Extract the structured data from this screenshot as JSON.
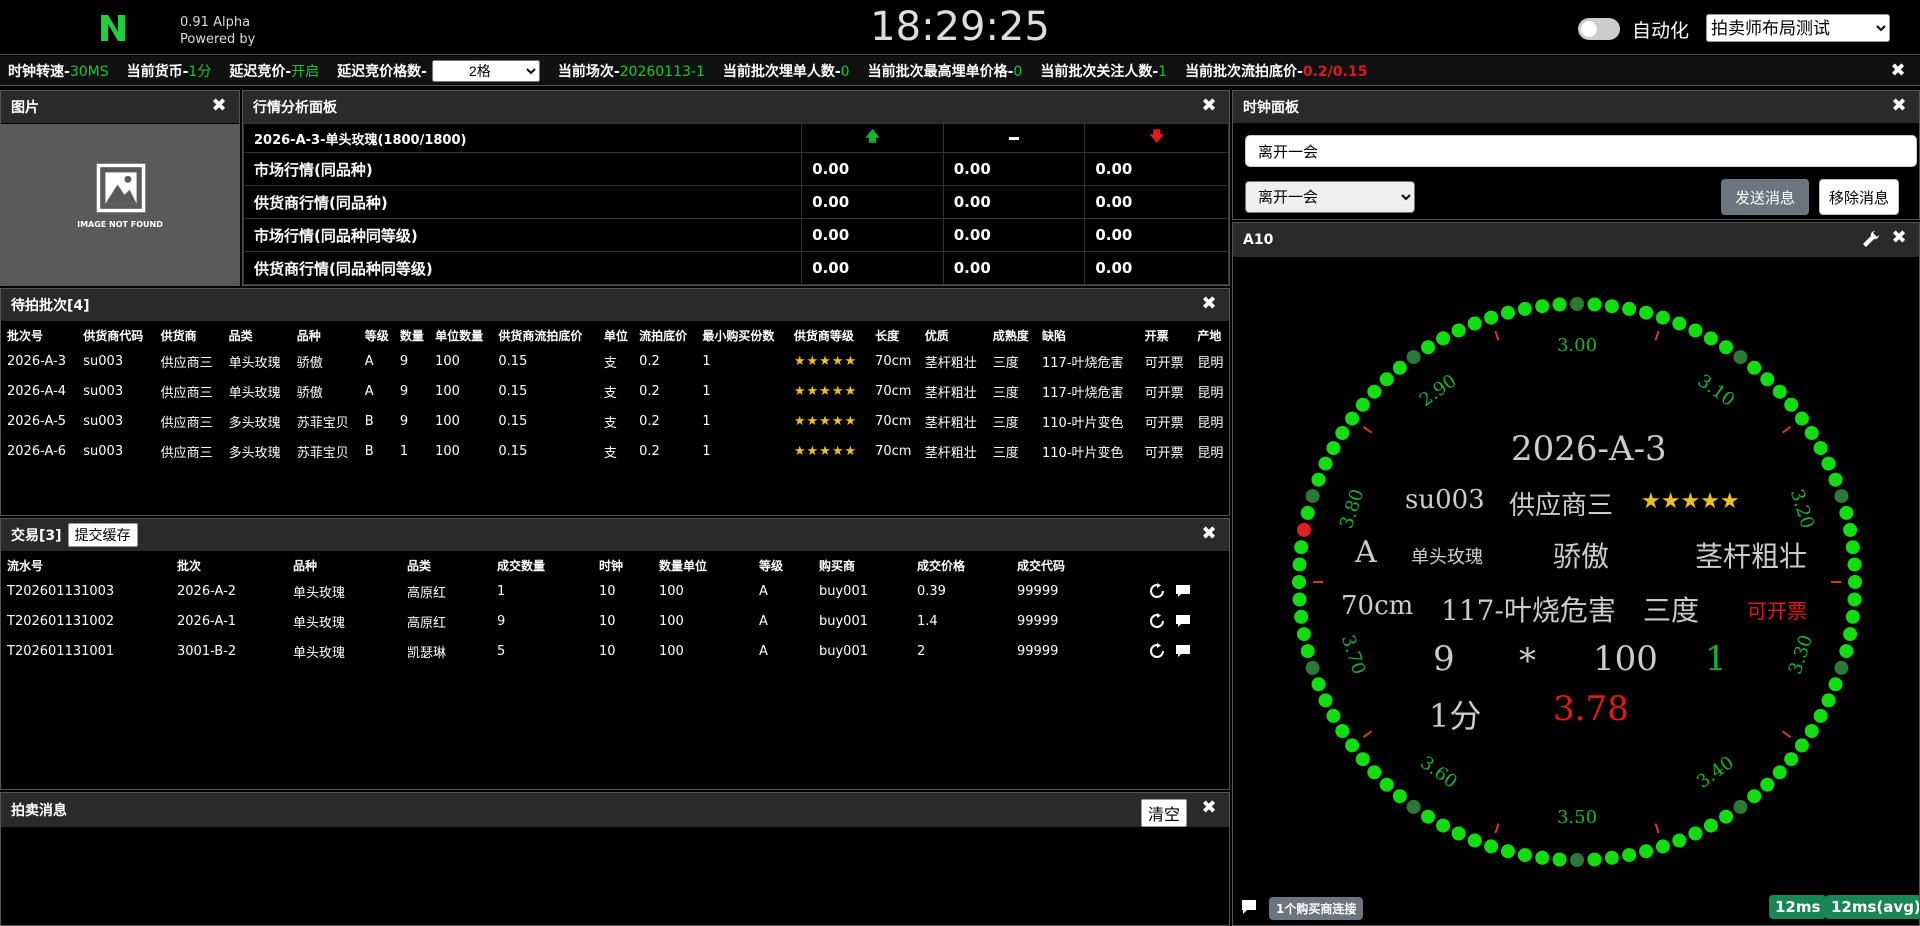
{
  "header": {
    "version": "0.91 Alpha",
    "powered_by": "Powered by",
    "clock": "18:29:25",
    "auto_label": "自动化",
    "layout_selected": "拍卖师布局测试"
  },
  "status": {
    "clock_speed_label": "时钟转速-",
    "clock_speed": "30MS",
    "currency_label": "当前货币-",
    "currency": "1分",
    "delay_label": "延迟竞价-",
    "delay": "开启",
    "delay_count_label": "延迟竞价格数-",
    "delay_count": "2格",
    "session_label": "当前场次-",
    "session": "20260113-1",
    "bidders_label": "当前批次埋单人数-",
    "bidders": "0",
    "max_bid_label": "当前批次最高埋单价格-",
    "max_bid": "0",
    "followers_label": "当前批次关注人数-",
    "followers": "1",
    "floor_label": "当前批次流拍底价-",
    "floor": "0.2/0.15"
  },
  "image_panel": {
    "title": "图片",
    "placeholder": "IMAGE NOT FOUND"
  },
  "market_panel": {
    "title": "行情分析面板",
    "lot_label": "2026-A-3-单头玫瑰(1800/1800)",
    "rows": [
      {
        "label": "市场行情(同品种)",
        "v1": "0.00",
        "v2": "0.00",
        "v3": "0.00"
      },
      {
        "label": "供货商行情(同品种)",
        "v1": "0.00",
        "v2": "0.00",
        "v3": "0.00"
      },
      {
        "label": "市场行情(同品种同等级)",
        "v1": "0.00",
        "v2": "0.00",
        "v3": "0.00"
      },
      {
        "label": "供货商行情(同品种同等级)",
        "v1": "0.00",
        "v2": "0.00",
        "v3": "0.00"
      }
    ]
  },
  "pending_panel": {
    "title": "待拍批次[4]",
    "headers": [
      "批次号",
      "供货商代码",
      "供货商",
      "品类",
      "品种",
      "等级",
      "数量",
      "单位数量",
      "供货商流拍底价",
      "单位",
      "流拍底价",
      "最小购买份数",
      "供货商等级",
      "长度",
      "优质",
      "成熟度",
      "缺陷",
      "开票",
      "产地"
    ],
    "rows": [
      [
        "2026-A-3",
        "su003",
        "供应商三",
        "单头玫瑰",
        "骄傲",
        "A",
        "9",
        "100",
        "0.15",
        "支",
        "0.2",
        "1",
        "★★★★★",
        "70cm",
        "茎杆粗壮",
        "三度",
        "117-叶烧危害",
        "可开票",
        "昆明"
      ],
      [
        "2026-A-4",
        "su003",
        "供应商三",
        "单头玫瑰",
        "骄傲",
        "A",
        "9",
        "100",
        "0.15",
        "支",
        "0.2",
        "1",
        "★★★★★",
        "70cm",
        "茎杆粗壮",
        "三度",
        "117-叶烧危害",
        "可开票",
        "昆明"
      ],
      [
        "2026-A-5",
        "su003",
        "供应商三",
        "多头玫瑰",
        "苏菲宝贝",
        "B",
        "9",
        "100",
        "0.15",
        "支",
        "0.2",
        "1",
        "★★★★★",
        "70cm",
        "茎杆粗壮",
        "三度",
        "110-叶片变色",
        "可开票",
        "昆明"
      ],
      [
        "2026-A-6",
        "su003",
        "供应商三",
        "多头玫瑰",
        "苏菲宝贝",
        "B",
        "1",
        "100",
        "0.15",
        "支",
        "0.2",
        "1",
        "★★★★★",
        "70cm",
        "茎杆粗壮",
        "三度",
        "110-叶片变色",
        "可开票",
        "昆明"
      ]
    ]
  },
  "trade_panel": {
    "title": "交易[3]",
    "commit_label": "提交缓存",
    "headers": [
      "流水号",
      "批次",
      "品种",
      "品类",
      "成交数量",
      "时钟",
      "数量单位",
      "等级",
      "购买商",
      "成交价格",
      "成交代码"
    ],
    "rows": [
      [
        "T202601131003",
        "2026-A-2",
        "单头玫瑰",
        "高原红",
        "1",
        "10",
        "100",
        "A",
        "buy001",
        "0.39",
        "99999"
      ],
      [
        "T202601131002",
        "2026-A-1",
        "单头玫瑰",
        "高原红",
        "9",
        "10",
        "100",
        "A",
        "buy001",
        "1.4",
        "99999"
      ],
      [
        "T202601131001",
        "3001-B-2",
        "单头玫瑰",
        "凯瑟琳",
        "5",
        "10",
        "100",
        "A",
        "buy001",
        "2",
        "99999"
      ]
    ]
  },
  "message_panel": {
    "title": "拍卖消息",
    "clear_label": "清空"
  },
  "clock_panel": {
    "title": "时钟面板",
    "message_value": "离开一会",
    "message_selected": "离开一会",
    "send_label": "发送消息",
    "remove_label": "移除消息"
  },
  "dial_panel": {
    "title": "A10",
    "lot": "2026-A-3",
    "supplier_code": "su003",
    "supplier": "供应商三",
    "stars": "★★★★★",
    "grade": "A",
    "category": "单头玫瑰",
    "variety": "骄傲",
    "quality": "茎杆粗壮",
    "length": "70cm",
    "defect": "117-叶烧危害",
    "maturity": "三度",
    "invoice": "可开票",
    "qty": "9",
    "times": "*",
    "unit_qty": "100",
    "min_buy": "1",
    "currency": "1分",
    "price": "3.78",
    "ticks": [
      "3.00",
      "3.10",
      "3.20",
      "3.30",
      "3.40",
      "3.50",
      "3.60",
      "3.70",
      "3.80",
      "2.90"
    ],
    "buyer_conn": "1个购买商连接",
    "latency": "12ms",
    "latency_avg": "12ms(avg)",
    "colors": {
      "dot": "#11dd11",
      "dot_dark": "#2a7a35",
      "current": "#e02020",
      "tick": "#d04010"
    }
  }
}
